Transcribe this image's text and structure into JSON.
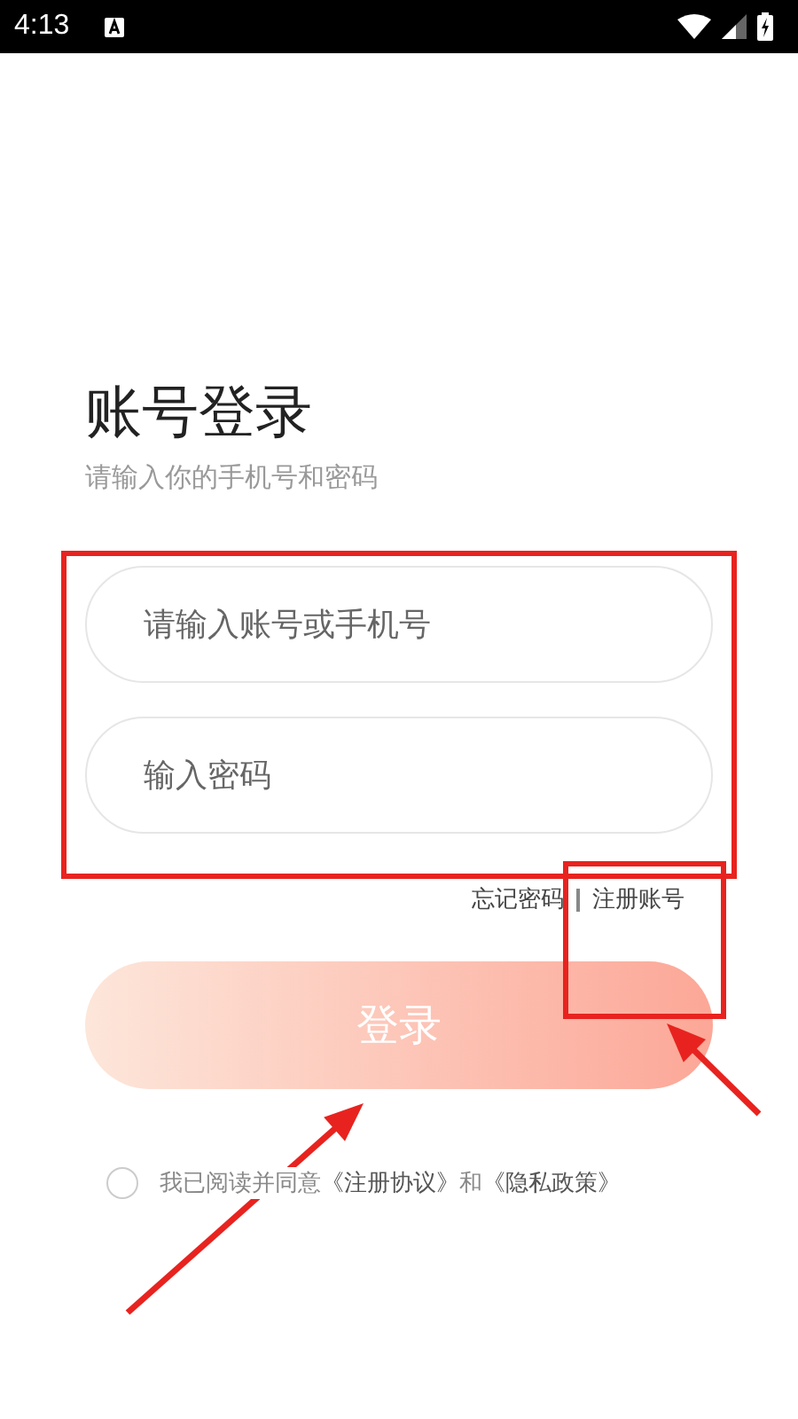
{
  "status_bar": {
    "time": "4:13"
  },
  "title": "账号登录",
  "subtitle": "请输入你的手机号和密码",
  "fields": [
    {
      "placeholder": "请输入账号或手机号"
    },
    {
      "placeholder": "输入密码"
    }
  ],
  "links": [
    {
      "label": "忘记密码"
    },
    {
      "label": "注册账号"
    }
  ],
  "login_button": {
    "label": "登录",
    "disabled": true
  },
  "agreement": {
    "checked": false,
    "text": "我已阅读并同意",
    "terms_link": "《注册协议》",
    "and": "和",
    "privacy_link": "《隐私政策》"
  },
  "annotations": [
    {
      "kind": "box"
    },
    {
      "kind": "box"
    },
    {
      "kind": "arrow"
    },
    {
      "kind": "arrow"
    }
  ]
}
